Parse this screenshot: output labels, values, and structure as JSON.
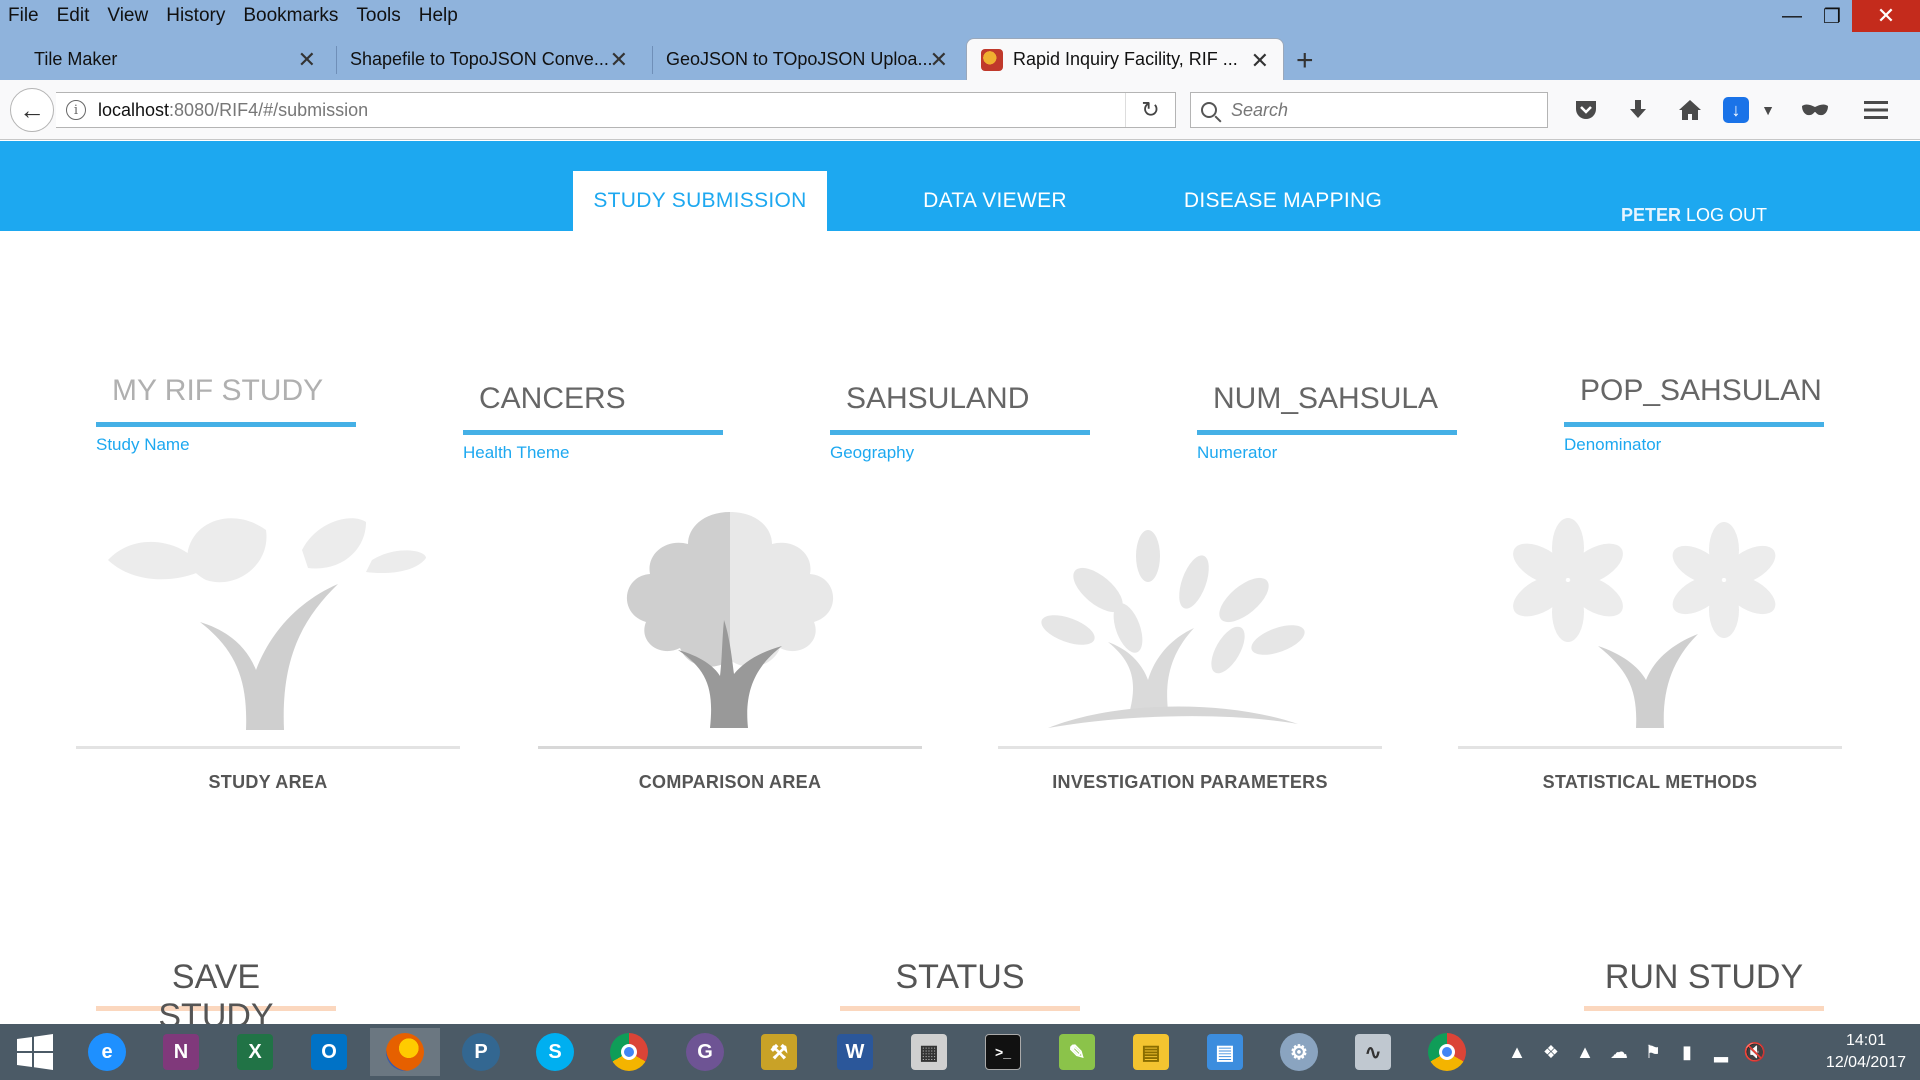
{
  "browser": {
    "menu": [
      "File",
      "Edit",
      "View",
      "History",
      "Bookmarks",
      "Tools",
      "Help"
    ],
    "tabs": [
      {
        "title": "Tile Maker"
      },
      {
        "title": "Shapefile to TopoJSON Conve..."
      },
      {
        "title": "GeoJSON to TOpoJSON Uploa..."
      },
      {
        "title": "Rapid Inquiry Facility, RIF ..."
      }
    ],
    "url_host": "localhost",
    "url_rest": ":8080/RIF4/#/submission",
    "search_placeholder": "Search"
  },
  "app": {
    "nav": {
      "study_submission": "STUDY SUBMISSION",
      "data_viewer": "DATA VIEWER",
      "disease_mapping": "DISEASE MAPPING"
    },
    "user": "PETER",
    "logout": "LOG OUT",
    "fields": [
      {
        "value": "MY RIF STUDY",
        "label": "Study Name"
      },
      {
        "value": "CANCERS",
        "label": "Health Theme"
      },
      {
        "value": "SAHSULAND",
        "label": "Geography"
      },
      {
        "value": "NUM_SAHSULA",
        "label": "Numerator"
      },
      {
        "value": "POP_SAHSULAN",
        "label": "Denominator"
      }
    ],
    "tiles": [
      "STUDY AREA",
      "COMPARISON AREA",
      "INVESTIGATION PARAMETERS",
      "STATISTICAL METHODS"
    ],
    "actions": {
      "save": "SAVE STUDY",
      "status": "STATUS",
      "run": "RUN STUDY"
    },
    "colors": {
      "header": "#1da8f0",
      "field_line": "#45b0e6",
      "action_line": "#fbd7be"
    }
  },
  "taskbar": {
    "time": "14:01",
    "date": "12/04/2017"
  }
}
